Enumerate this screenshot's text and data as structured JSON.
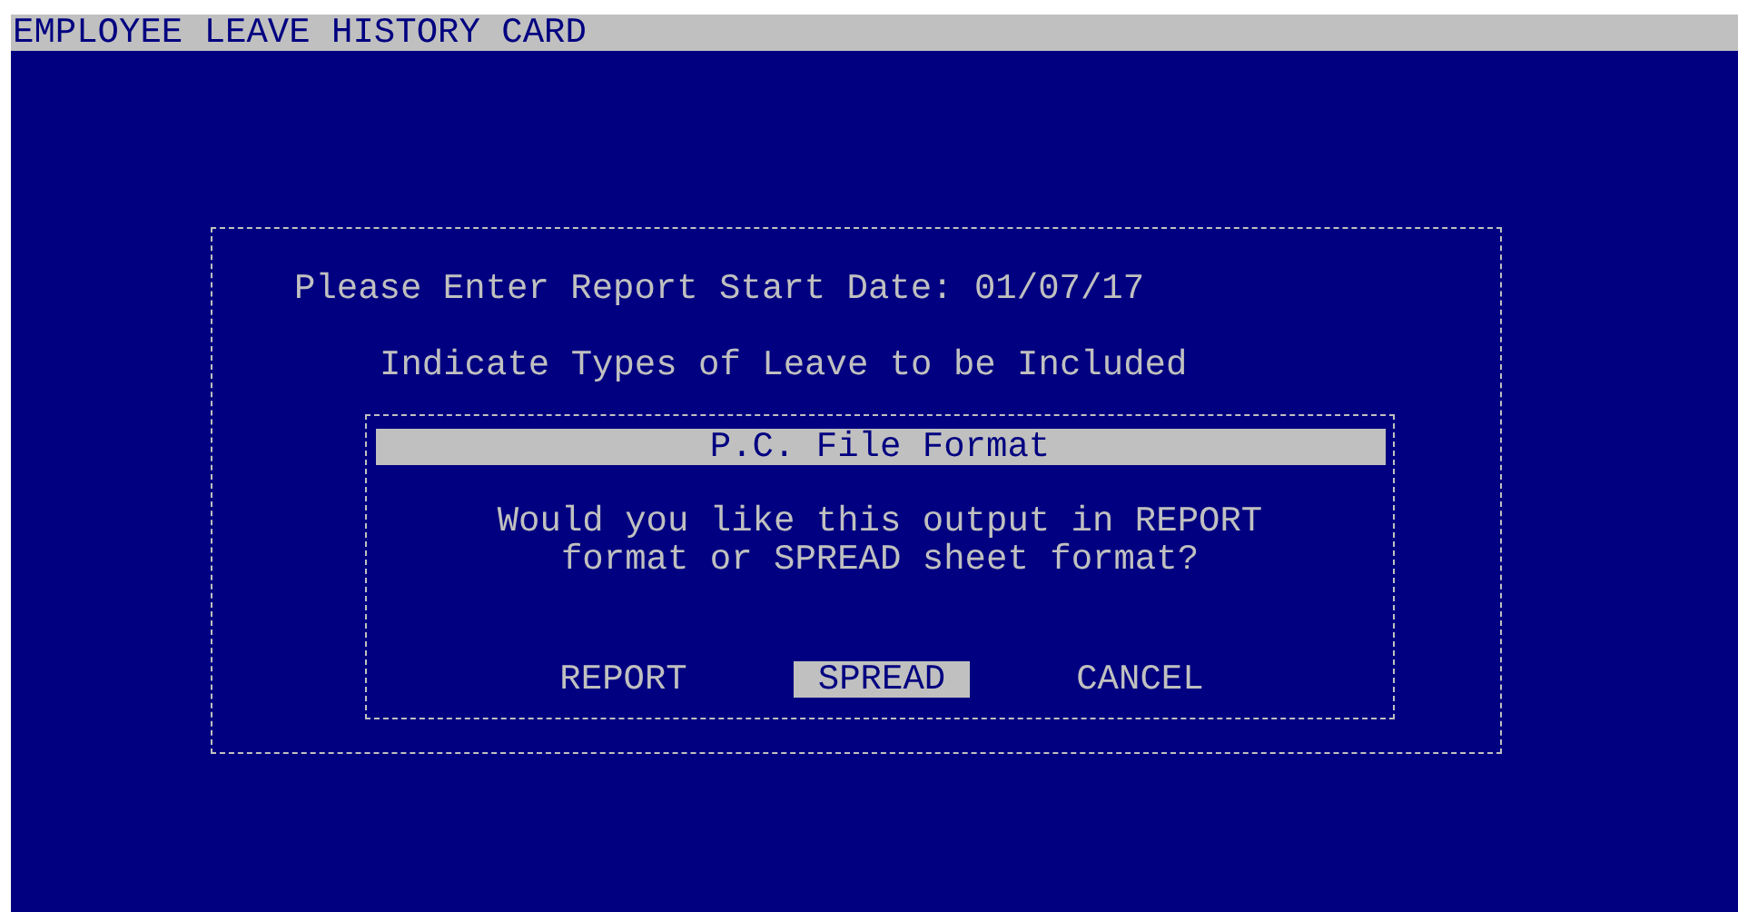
{
  "title_bar": {
    "title": "EMPLOYEE LEAVE HISTORY CARD"
  },
  "form": {
    "date_label": "Please Enter Report Start Date:",
    "date_value": "01/07/17",
    "leave_types_label": "Indicate Types of Leave to be Included"
  },
  "dialog": {
    "title": "P.C. File Format",
    "message_lines": [
      "Would you like this output in REPORT",
      "format or SPREAD sheet format?"
    ],
    "buttons": [
      {
        "label": "REPORT",
        "selected": false
      },
      {
        "label": "SPREAD",
        "selected": true
      },
      {
        "label": "CANCEL",
        "selected": false
      }
    ]
  }
}
